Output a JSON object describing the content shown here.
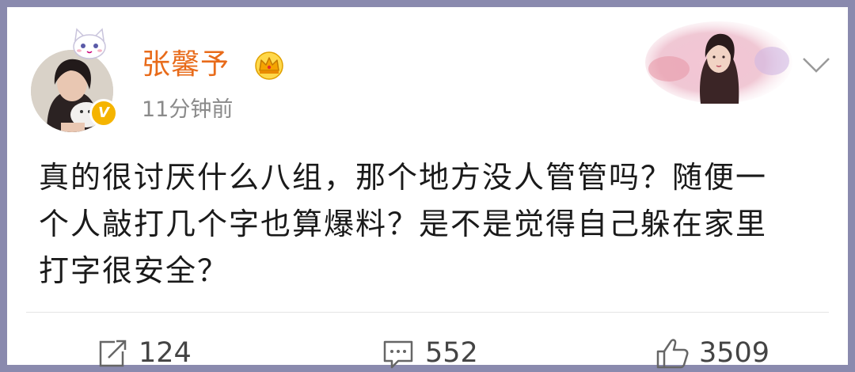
{
  "post": {
    "author": {
      "name": "张馨予",
      "verified_badge": "V"
    },
    "timestamp": "11分钟前",
    "text_lines": [
      "真的很讨厌什么八组，那个地方没人管管吗？随便一",
      "个人敲打几个字也算爆料？是不是觉得自己躲在家里",
      "打字很安全？"
    ]
  },
  "actions": {
    "repost": {
      "count": "124",
      "icon": "share-icon"
    },
    "comment": {
      "count": "552",
      "icon": "comment-icon"
    },
    "like": {
      "count": "3509",
      "icon": "thumbs-up-icon"
    }
  },
  "colors": {
    "username": "#e86b1a",
    "frame": "#8a8aae",
    "badge": "#f5b400",
    "timestamp": "#8a8a8a"
  }
}
